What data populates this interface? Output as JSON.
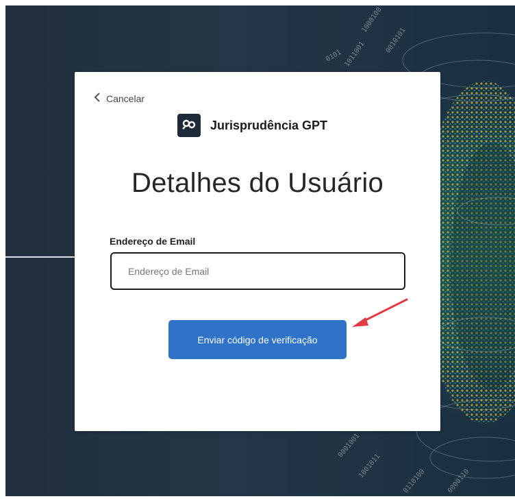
{
  "cancel": {
    "label": "Cancelar",
    "icon": "chevron-left-icon"
  },
  "brand": {
    "name": "Jurisprudência GPT",
    "logo_icon": "double-link-icon",
    "logo_bg": "#1f2a38"
  },
  "page": {
    "title": "Detalhes do Usuário"
  },
  "email": {
    "label": "Endereço de Email",
    "placeholder": "Endereço de Email",
    "value": ""
  },
  "submit": {
    "label": "Enviar código de verificação",
    "color": "#2f73c9"
  },
  "annotation": {
    "arrow_color": "#e23b45"
  }
}
